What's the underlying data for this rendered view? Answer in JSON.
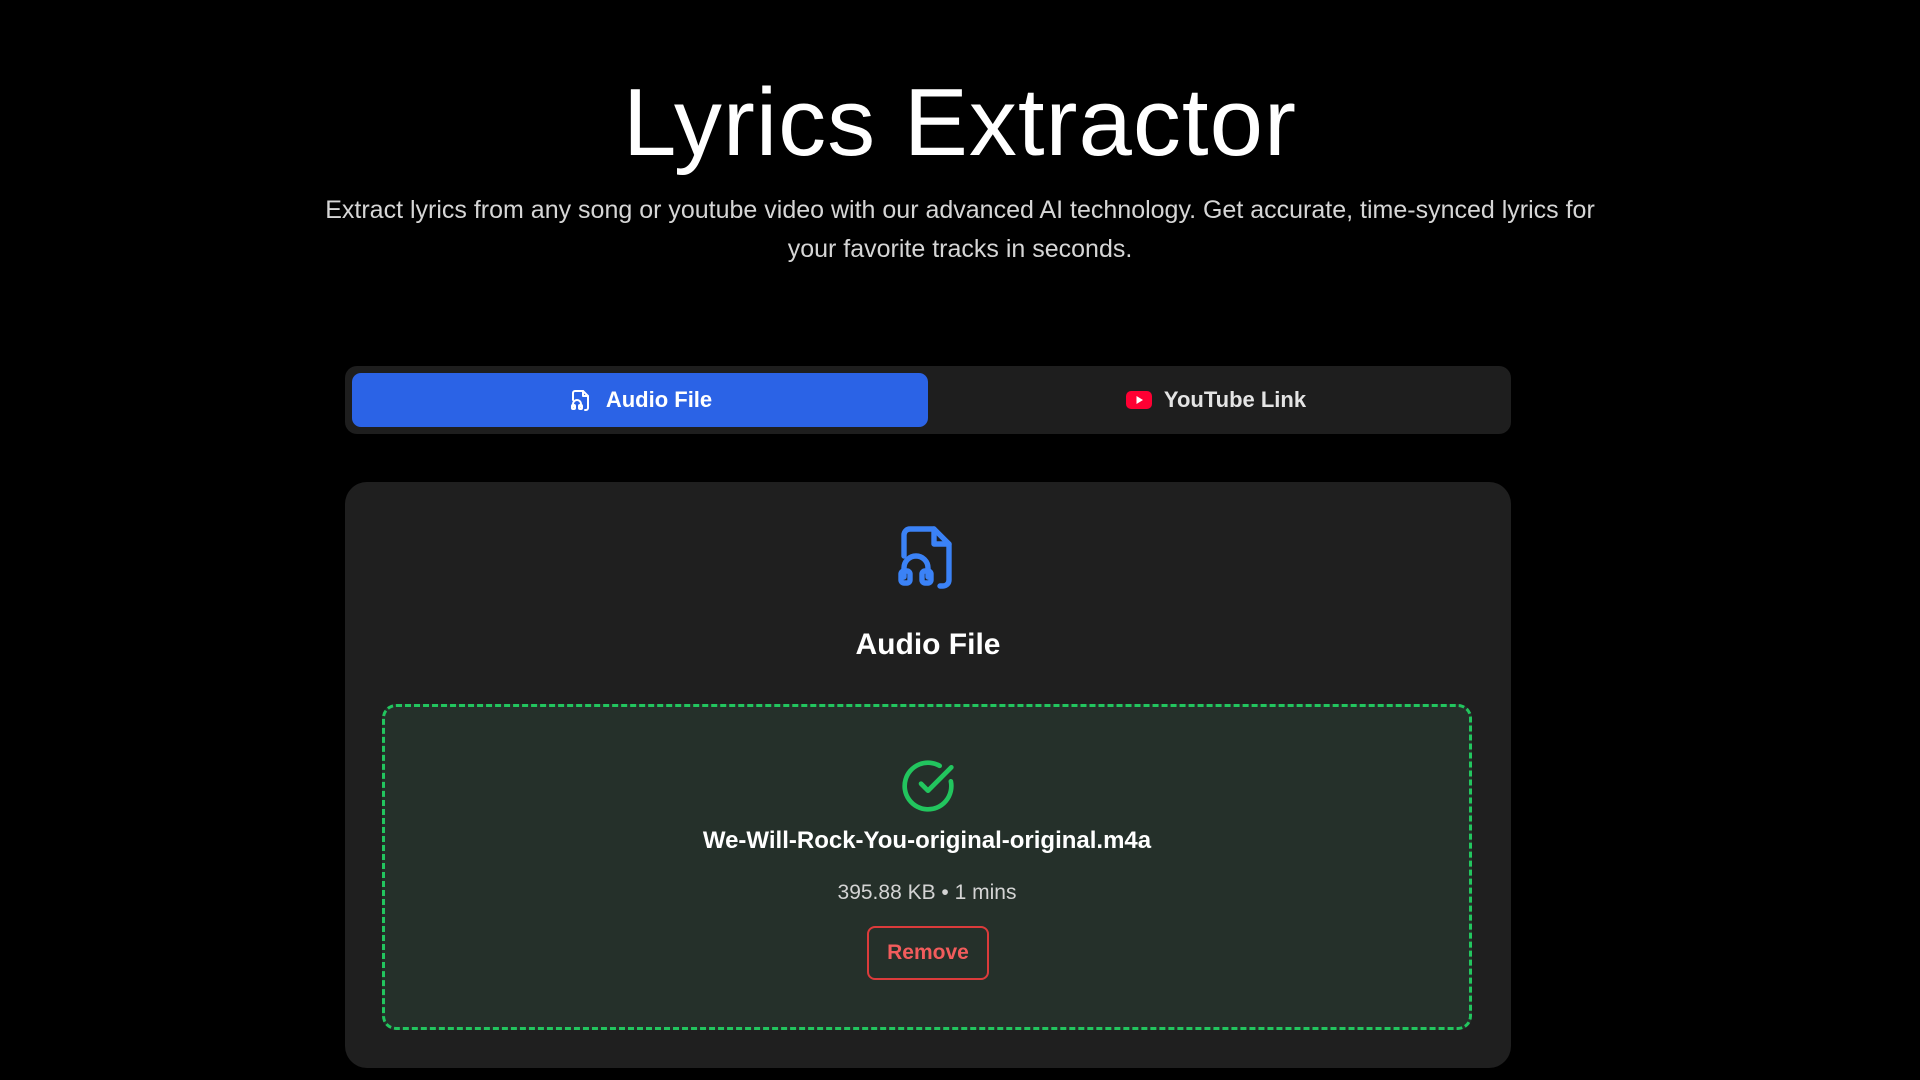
{
  "hero": {
    "title": "Lyrics Extractor",
    "subtitle": "Extract lyrics from any song or youtube video with our advanced AI technology. Get accurate, time-synced lyrics for your favorite tracks in seconds."
  },
  "tabs": [
    {
      "label": "Audio File",
      "icon": "audio-file-icon",
      "active": true
    },
    {
      "label": "YouTube Link",
      "icon": "youtube-icon",
      "active": false
    }
  ],
  "card": {
    "icon": "audio-file-icon",
    "title": "Audio File"
  },
  "upload": {
    "status_icon": "check-circle-icon",
    "file_name": "We-Will-Rock-You-original-original.m4a",
    "file_meta": "395.88 KB • 1 mins",
    "remove_label": "Remove"
  },
  "colors": {
    "background": "#000000",
    "accent": "#2b63e6",
    "success": "#22c55e",
    "danger": "#dc3b3b",
    "youtube": "#ff0033"
  }
}
